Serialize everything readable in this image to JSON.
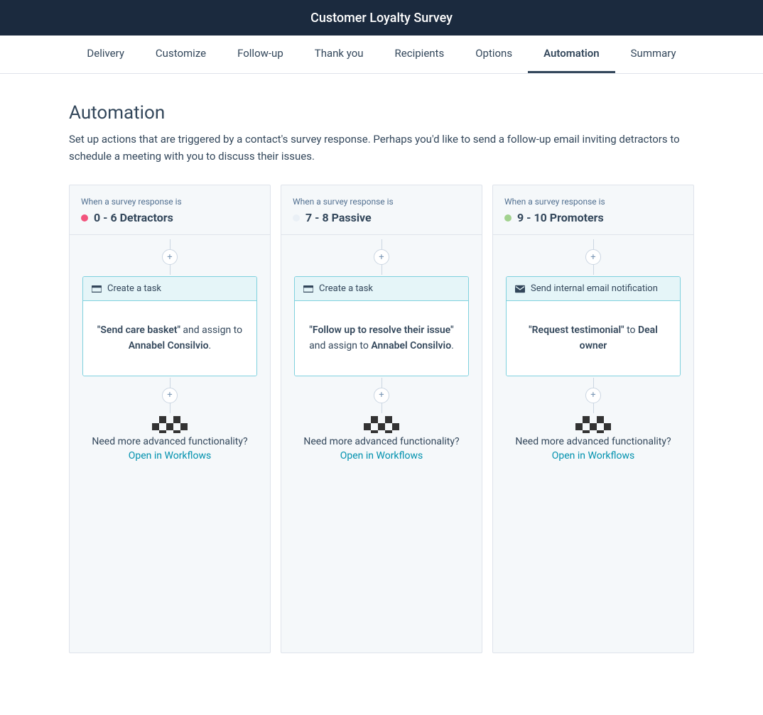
{
  "header": {
    "title": "Customer Loyalty Survey"
  },
  "tabs": {
    "items": [
      {
        "label": "Delivery",
        "active": false
      },
      {
        "label": "Customize",
        "active": false
      },
      {
        "label": "Follow-up",
        "active": false
      },
      {
        "label": "Thank you",
        "active": false
      },
      {
        "label": "Recipients",
        "active": false
      },
      {
        "label": "Options",
        "active": false
      },
      {
        "label": "Automation",
        "active": true
      },
      {
        "label": "Summary",
        "active": false
      }
    ]
  },
  "page": {
    "title": "Automation",
    "description": "Set up actions that are triggered by a contact's survey response. Perhaps you'd like to send a follow-up email inviting detractors to schedule a meeting with you to discuss their issues."
  },
  "columns": [
    {
      "pre": "When a survey response is",
      "title": "0 - 6 Detractors",
      "dot_color": "#f2547d",
      "action": {
        "type": "task",
        "header": "Create a task",
        "quoted": "\"Send care basket\"",
        "mid": " and assign to ",
        "assignee": "Annabel Consilvio",
        "suffix": "."
      },
      "footer": {
        "advanced": "Need more advanced functionality?",
        "link": "Open in Workflows"
      }
    },
    {
      "pre": "When a survey response is",
      "title": "7 - 8 Passive",
      "dot_color": "#eaf0f6",
      "action": {
        "type": "task",
        "header": "Create a task",
        "quoted": "\"Follow up to resolve their issue\"",
        "mid": " and assign to ",
        "assignee": "Annabel Consilvio",
        "suffix": "."
      },
      "footer": {
        "advanced": "Need more advanced functionality?",
        "link": "Open in Workflows"
      }
    },
    {
      "pre": "When a survey response is",
      "title": "9 - 10 Promoters",
      "dot_color": "#a2d28f",
      "action": {
        "type": "email",
        "header": "Send internal email notification",
        "quoted": "\"Request testimonial\"",
        "mid": " to ",
        "assignee": "Deal owner",
        "suffix": ""
      },
      "footer": {
        "advanced": "Need more advanced functionality?",
        "link": "Open in Workflows"
      }
    }
  ],
  "icons": {
    "plus": "+"
  }
}
